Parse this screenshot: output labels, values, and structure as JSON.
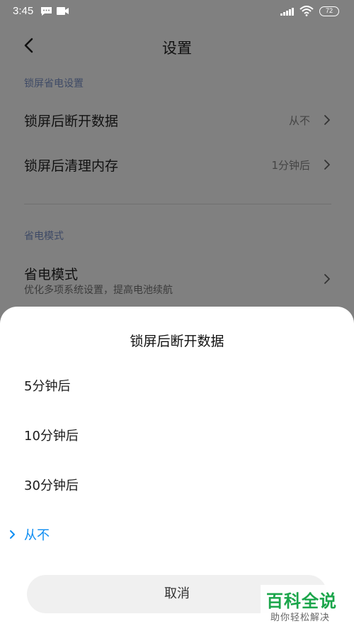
{
  "status_bar": {
    "time": "3:45",
    "battery": "72",
    "icons": [
      "message-icon",
      "video-icon",
      "signal-icon",
      "wifi-icon",
      "battery-icon"
    ]
  },
  "header": {
    "title": "设置",
    "back_icon": "back-arrow-icon"
  },
  "sections": [
    {
      "label": "锁屏省电设置",
      "rows": [
        {
          "label": "锁屏后断开数据",
          "value": "从不"
        },
        {
          "label": "锁屏后清理内存",
          "value": "1分钟后"
        }
      ]
    },
    {
      "label": "省电模式",
      "rows": [
        {
          "label": "省电模式",
          "subtitle": "优化多项系统设置，提高电池续航"
        }
      ]
    }
  ],
  "sheet": {
    "title": "锁屏后断开数据",
    "options": [
      {
        "label": "5分钟后",
        "selected": false
      },
      {
        "label": "10分钟后",
        "selected": false
      },
      {
        "label": "30分钟后",
        "selected": false
      },
      {
        "label": "从不",
        "selected": true
      }
    ],
    "cancel_label": "取消"
  },
  "watermark": {
    "main": "百科全说",
    "sub": "助你轻松解决"
  },
  "colors": {
    "accent": "#0d8df2",
    "overlay_background": "#808080",
    "sheet_background": "#ffffff",
    "watermark_green": "#1aa54a"
  }
}
